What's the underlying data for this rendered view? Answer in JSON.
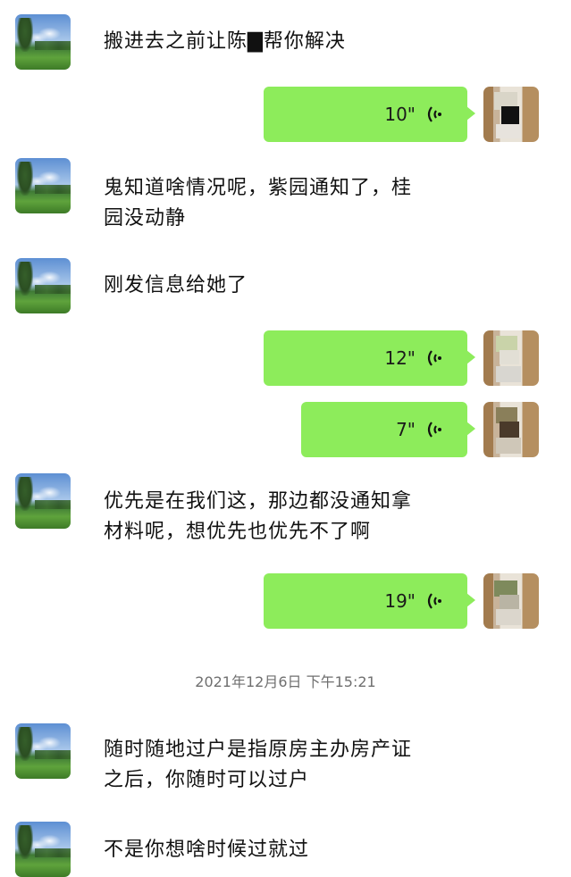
{
  "messages": [
    {
      "type": "text",
      "side": "left",
      "text": "搬进去之前让陈▇帮你解决"
    },
    {
      "type": "voice",
      "side": "right",
      "duration": "10\""
    },
    {
      "type": "text",
      "side": "left",
      "lines": [
        "鬼知道啥情况呢，紫园通知了，桂",
        "园没动静"
      ]
    },
    {
      "type": "text",
      "side": "left",
      "text": "刚发信息给她了"
    },
    {
      "type": "voice",
      "side": "right",
      "duration": "12\""
    },
    {
      "type": "voice",
      "side": "right",
      "duration": "7\""
    },
    {
      "type": "text",
      "side": "left",
      "lines": [
        "优先是在我们这，那边都没通知拿",
        "材料呢，想优先也优先不了啊"
      ]
    },
    {
      "type": "voice",
      "side": "right",
      "duration": "19\""
    },
    {
      "type": "timestamp",
      "text": "2021年12月6日 下午15:21"
    },
    {
      "type": "text",
      "side": "left",
      "lines": [
        "随时随地过户是指原房主办房产证",
        "之后，你随时可以过户"
      ]
    },
    {
      "type": "text",
      "side": "left",
      "text": "不是你想啥时候过就过"
    }
  ],
  "icons": {
    "voice": "voice-wave-icon",
    "left_avatar": "landscape-avatar",
    "right_avatar": "mosaic-avatar"
  },
  "colors": {
    "bubble": "#8dec5b",
    "background": "#ffffff",
    "timestamp": "#6f6f6f"
  }
}
